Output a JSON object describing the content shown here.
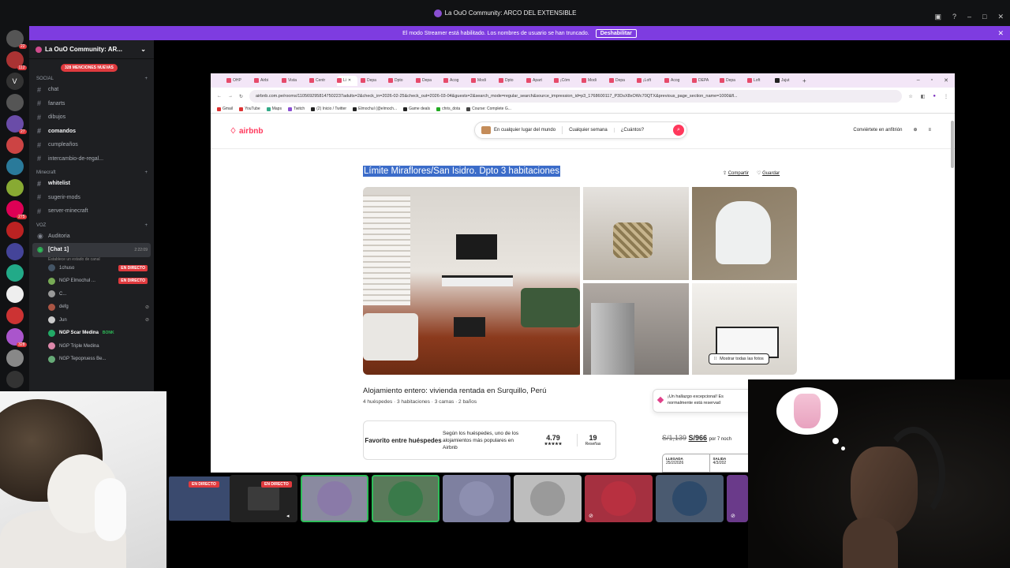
{
  "discord": {
    "window_title": "La OuO Community: ARCO DEL EXTENSIBLE",
    "streamer_notice": "El modo Streamer está habilitado. Los nombres de usuario se han truncado.",
    "disable_label": "Deshabilitar",
    "guild_name": "La OuO Community: AR...",
    "mentions_badge": "328 MENCIONES NUEVAS",
    "server_badges": [
      "22",
      "112",
      "27",
      "275",
      "328"
    ],
    "categories": [
      {
        "label": "SOCIAL"
      },
      {
        "label": "Minecraft"
      },
      {
        "label": "VOZ"
      }
    ],
    "social_channels": [
      "chat",
      "fanarts",
      "dibujos",
      "comandos",
      "cumpleaños",
      "intercambio-de-regal..."
    ],
    "minecraft_channels": [
      "whitelist",
      "sugerir-mods",
      "server-minecraft"
    ],
    "voice_channels": [
      {
        "name": "Auditoria"
      },
      {
        "name": "[Chat 1]",
        "timer": "2:22:09"
      }
    ],
    "voice_status": "Establece un estado de canal",
    "voice_users": [
      {
        "name": "1chuso",
        "live": "EN DIRECTO"
      },
      {
        "name": "NGP Elmochul ...",
        "live": "EN DIRECTO"
      },
      {
        "name": "C..."
      },
      {
        "name": "defg"
      },
      {
        "name": "Jun"
      },
      {
        "name": "NGP Scar Medina",
        "tag": "BONK"
      },
      {
        "name": "NGP Triple Medina"
      },
      {
        "name": "NGP Tepopruess Be..."
      }
    ]
  },
  "browser": {
    "tabs": [
      "OHP",
      "Airbi",
      "Vista",
      "Centr",
      "Li",
      "Depa",
      "Dpto",
      "Depa",
      "Acog",
      "Modi",
      "Dpto",
      "Apart",
      "¡Cóm",
      "Modi",
      "Depa",
      "¡Loft",
      "Acog",
      "DEPA",
      "Depa",
      "Loft",
      "Jujut"
    ],
    "url": "airbnb.com.pe/rooms/1105692958147502237adults=2&check_in=2026-02-25&check_out=2026-03-04&guests=2&search_mode=regular_search&source_impression_id=p3_1768600117_P3DsX8xOWc70QTX&previous_page_section_name=1000&fl...",
    "bookmarks": [
      "Gmail",
      "YouTube",
      "Maps",
      "Twitch",
      "(2) Inicio / Twitter",
      "Elmochul (@elmoch...",
      "Game deals",
      "chris_dota",
      "Course: Complete G..."
    ]
  },
  "airbnb": {
    "logo": "airbnb",
    "search": {
      "where": "En cualquier lugar del mundo",
      "when": "Cualquier semana",
      "who": "¿Cuántos?"
    },
    "host_link": "Conviértete en anfitrión",
    "title": "Límite Miraflores/San Isidro. Dpto 3 habitaciones",
    "share": "Compartir",
    "save": "Guardar",
    "show_all_photos": "Mostrar todas las fotos",
    "listing_type": "Alojamiento entero: vivienda rentada en Surquillo, Perú",
    "details": "4 huéspedes · 3 habitaciones · 3 camas · 2 baños",
    "guest_favorite": "Favorito entre huéspedes",
    "guest_favorite_desc": "Según los huéspedes, uno de los alojamientos más populares en Airbnb",
    "rating": "4.79",
    "stars": "★★★★★",
    "reviews_count": "19",
    "reviews_label": "Reseñas",
    "find_notice_1": "¡Un hallazgo excepcional! Es",
    "find_notice_2": "normalmente está reservad",
    "old_price": "S/1,139",
    "new_price": "S/966",
    "price_suffix": "por 7 noch",
    "checkin_label": "LLEGADA",
    "checkin_value": "25/2/2026",
    "checkout_label": "SALIDA",
    "checkout_value": "4/3/202"
  },
  "tiles": [
    {
      "live": "EN DIRECTO",
      "color": "#3a4a6e"
    },
    {
      "live": "EN DIRECTO",
      "color": "#3b3b3b"
    },
    {
      "color": "#8a7aa8"
    },
    {
      "color": "#3a7a4a"
    },
    {
      "color": "#8d8fb0"
    },
    {
      "color": "#9a9a9a"
    },
    {
      "color": "#b83040"
    },
    {
      "color": "#2e4a6a"
    }
  ]
}
